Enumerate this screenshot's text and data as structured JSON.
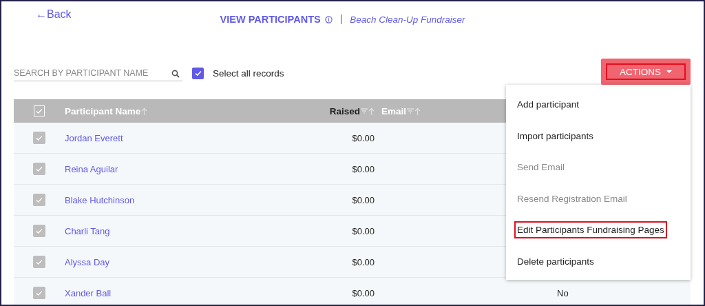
{
  "back_link": {
    "label": "←Back"
  },
  "header": {
    "title": "VIEW PARTICIPANTS",
    "event": "Beach Clean-Up Fundraiser"
  },
  "search": {
    "placeholder": "SEARCH BY PARTICIPANT NAME"
  },
  "select_all": {
    "label": "Select all records",
    "checked": true
  },
  "actions_button": {
    "label": "ACTIONS",
    "highlighted": true
  },
  "actions_menu": [
    {
      "label": "Add participant",
      "disabled": false,
      "highlighted": false
    },
    {
      "label": "Import participants",
      "disabled": false,
      "highlighted": false
    },
    {
      "label": "Send Email",
      "disabled": true,
      "highlighted": false
    },
    {
      "label": "Resend Registration Email",
      "disabled": true,
      "highlighted": false
    },
    {
      "label": "Edit Participants Fundraising Pages",
      "disabled": false,
      "highlighted": true
    },
    {
      "label": "Delete participants",
      "disabled": false,
      "highlighted": false
    }
  ],
  "table": {
    "header_checked": true,
    "columns": [
      {
        "label": "Participant Name",
        "filter": false
      },
      {
        "label": "Raised",
        "filter": true
      },
      {
        "label": "Email",
        "filter": true
      }
    ],
    "rows": [
      {
        "checked": true,
        "name": "Jordan Everett",
        "raised": "$0.00"
      },
      {
        "checked": true,
        "name": "Reina Aguilar",
        "raised": "$0.00"
      },
      {
        "checked": true,
        "name": "Blake Hutchinson",
        "raised": "$0.00"
      },
      {
        "checked": true,
        "name": "Charli Tang",
        "raised": "$0.00"
      },
      {
        "checked": true,
        "name": "Alyssa Day",
        "raised": "$0.00"
      },
      {
        "checked": true,
        "name": "Xander Ball",
        "raised": "$0.00",
        "column_4": "No"
      }
    ]
  }
}
